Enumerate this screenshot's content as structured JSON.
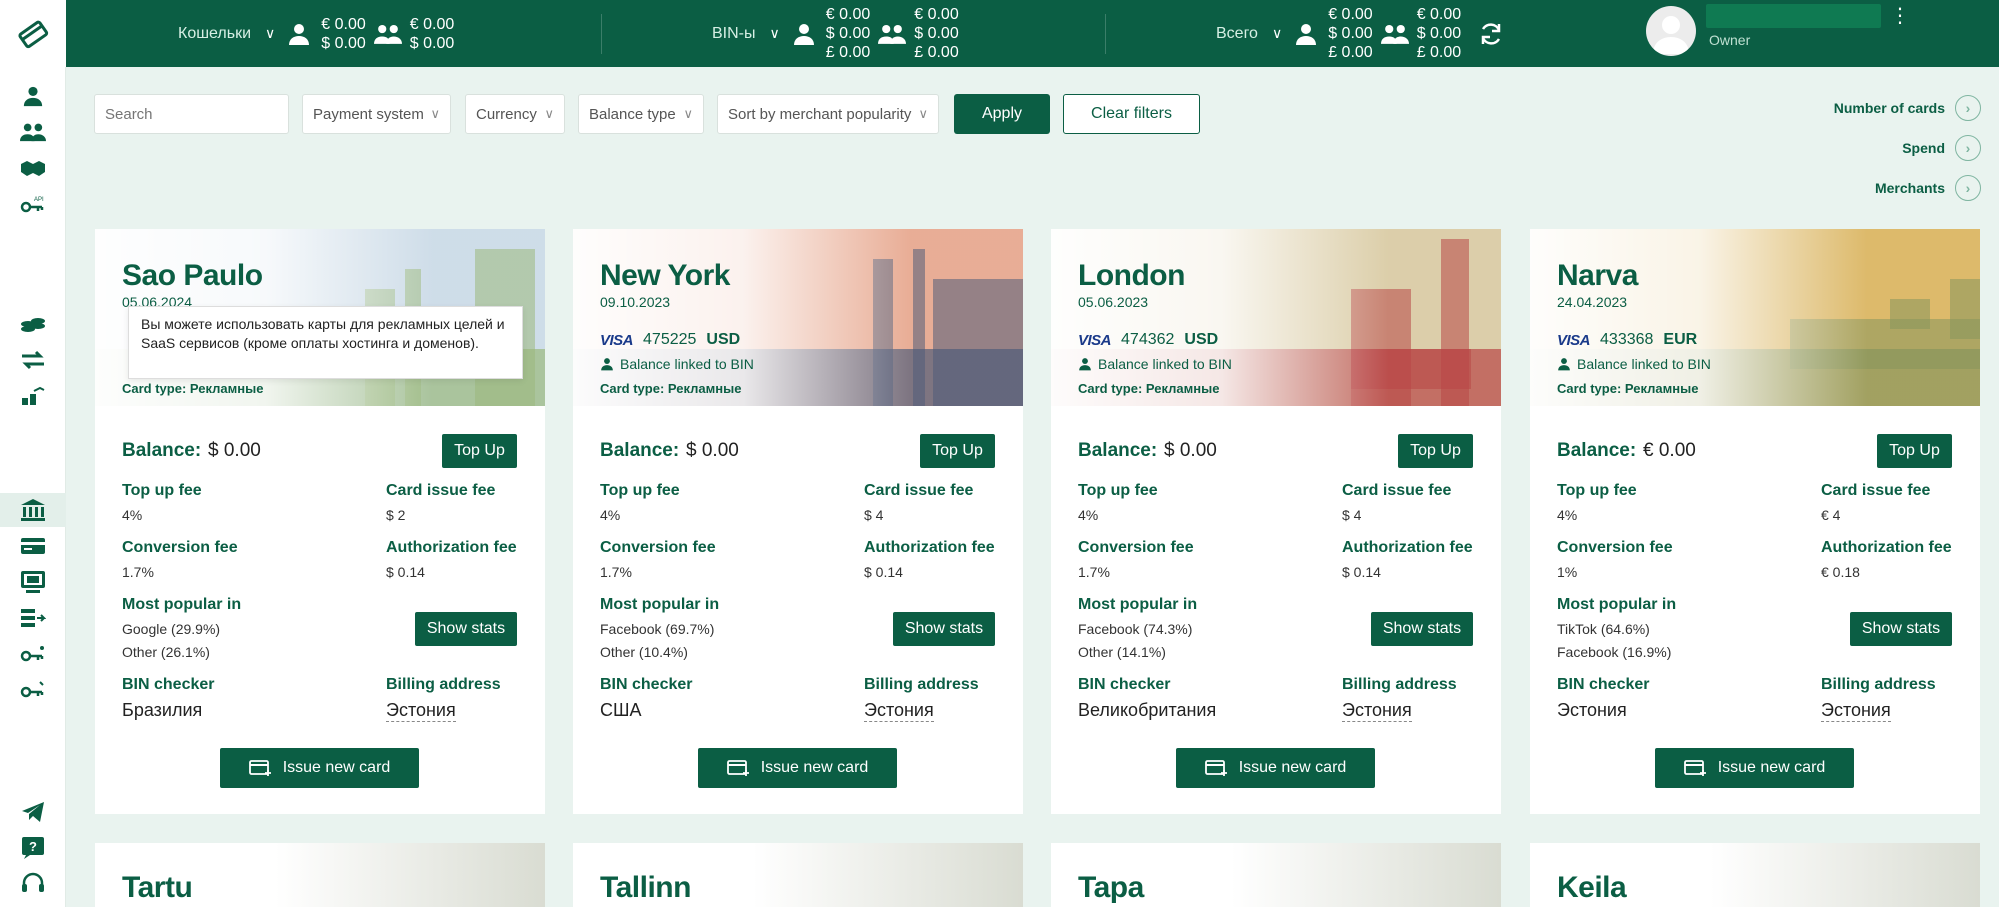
{
  "topbar": {
    "groups": [
      {
        "label": "Кошельки",
        "personal": [
          "€ 0.00",
          "$ 0.00"
        ],
        "team": [
          "€ 0.00",
          "$ 0.00"
        ]
      },
      {
        "label": "BIN-ы",
        "personal": [
          "€ 0.00",
          "$ 0.00",
          "£ 0.00"
        ],
        "team": [
          "€ 0.00",
          "$ 0.00",
          "£ 0.00"
        ]
      },
      {
        "label": "Всего",
        "personal": [
          "€ 0.00",
          "$ 0.00",
          "£ 0.00"
        ],
        "team": [
          "€ 0.00",
          "$ 0.00",
          "£ 0.00"
        ]
      }
    ],
    "user_role": "Owner"
  },
  "filters": {
    "search_placeholder": "Search",
    "payment_system": "Payment system",
    "currency": "Currency",
    "balance_type": "Balance type",
    "sort": "Sort by merchant popularity",
    "apply": "Apply",
    "clear": "Clear filters"
  },
  "sort_links": [
    "Number of cards",
    "Spend",
    "Merchants"
  ],
  "labels": {
    "balance": "Balance:",
    "top_up": "Top Up",
    "top_up_fee": "Top up fee",
    "card_issue_fee": "Card issue fee",
    "conversion_fee": "Conversion fee",
    "authorization_fee": "Authorization fee",
    "most_popular_in": "Most popular in",
    "show_stats": "Show stats",
    "bin_checker": "BIN checker",
    "billing_address": "Billing address",
    "issue_new_card": "Issue new card",
    "balance_linked": "Balance linked to BIN",
    "visa": "VISA"
  },
  "cards": [
    {
      "city": "Sao Paulo",
      "date": "05.06.2024",
      "bin": "",
      "currency": "",
      "tooltip": "Вы можете использовать карты для рекламных целей и SaaS сервисов (кроме оплаты хостинга и доменов).",
      "card_type": "Card type: Рекламные",
      "balance": "$ 0.00",
      "top_up_fee": "4%",
      "card_issue_fee": "$ 2",
      "conversion_fee": "1.7%",
      "authorization_fee": "$ 0.14",
      "popular": [
        "Google (29.9%)",
        "Other (26.1%)"
      ],
      "bin_country": "Бразилия",
      "billing_country": "Эстония",
      "hero_colors": [
        "#c9d9e6",
        "#8fb06e"
      ]
    },
    {
      "city": "New York",
      "date": "09.10.2023",
      "bin": "475225",
      "currency": "USD",
      "card_type": "Card type: Рекламные",
      "balance": "$ 0.00",
      "top_up_fee": "4%",
      "card_issue_fee": "$ 4",
      "conversion_fee": "1.7%",
      "authorization_fee": "$ 0.14",
      "popular": [
        "Facebook (69.7%)",
        "Other (10.4%)"
      ],
      "bin_country": "США",
      "billing_country": "Эстония",
      "hero_colors": [
        "#e6a48a",
        "#3c4a6a"
      ]
    },
    {
      "city": "London",
      "date": "05.06.2023",
      "bin": "474362",
      "currency": "USD",
      "card_type": "Card type: Рекламные",
      "balance": "$ 0.00",
      "top_up_fee": "4%",
      "card_issue_fee": "$ 4",
      "conversion_fee": "1.7%",
      "authorization_fee": "$ 0.14",
      "popular": [
        "Facebook (74.3%)",
        "Other (14.1%)"
      ],
      "bin_country": "Великобритания",
      "billing_country": "Эстония",
      "hero_colors": [
        "#d8c9a0",
        "#b03232"
      ]
    },
    {
      "city": "Narva",
      "date": "24.04.2023",
      "bin": "433368",
      "currency": "EUR",
      "card_type": "Card type: Рекламные",
      "balance": "€ 0.00",
      "top_up_fee": "4%",
      "card_issue_fee": "€ 4",
      "conversion_fee": "1%",
      "authorization_fee": "€ 0.18",
      "popular": [
        "TikTok (64.6%)",
        "Facebook (16.9%)"
      ],
      "bin_country": "Эстония",
      "billing_country": "Эстония",
      "hero_colors": [
        "#d9b25a",
        "#7a8a4a"
      ]
    }
  ],
  "more_cards": [
    "Tartu",
    "Tallinn",
    "Tapa",
    "Keila"
  ],
  "colors": {
    "brand": "#0b5e44",
    "background": "#e9f3ef"
  }
}
